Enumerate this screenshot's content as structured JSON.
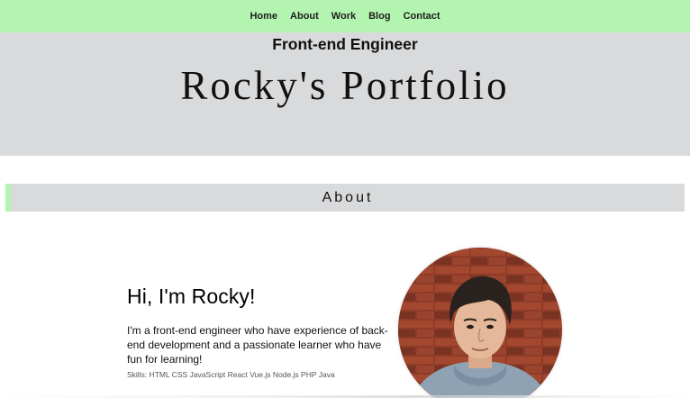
{
  "nav": {
    "items": [
      {
        "label": "Home"
      },
      {
        "label": "About"
      },
      {
        "label": "Work"
      },
      {
        "label": "Blog"
      },
      {
        "label": "Contact"
      }
    ]
  },
  "hero": {
    "subtitle": "Front-end Engineer",
    "title": "Rocky's Portfolio"
  },
  "section": {
    "title": "About"
  },
  "about": {
    "heading": "Hi, I'm Rocky!",
    "description": "I'm a front-end engineer who have experience of back-end development and a passionate learner who have fun for learning!",
    "skills": "Skills: HTML CSS JavaScript React Vue.js Node.js PHP Java"
  },
  "colors": {
    "nav_bg": "#b3f5b0",
    "hero_bg": "#d9dadc",
    "accent": "#b3f5b0",
    "brick": "#8b3a2a"
  },
  "icons": {
    "avatar": "profile-photo"
  }
}
